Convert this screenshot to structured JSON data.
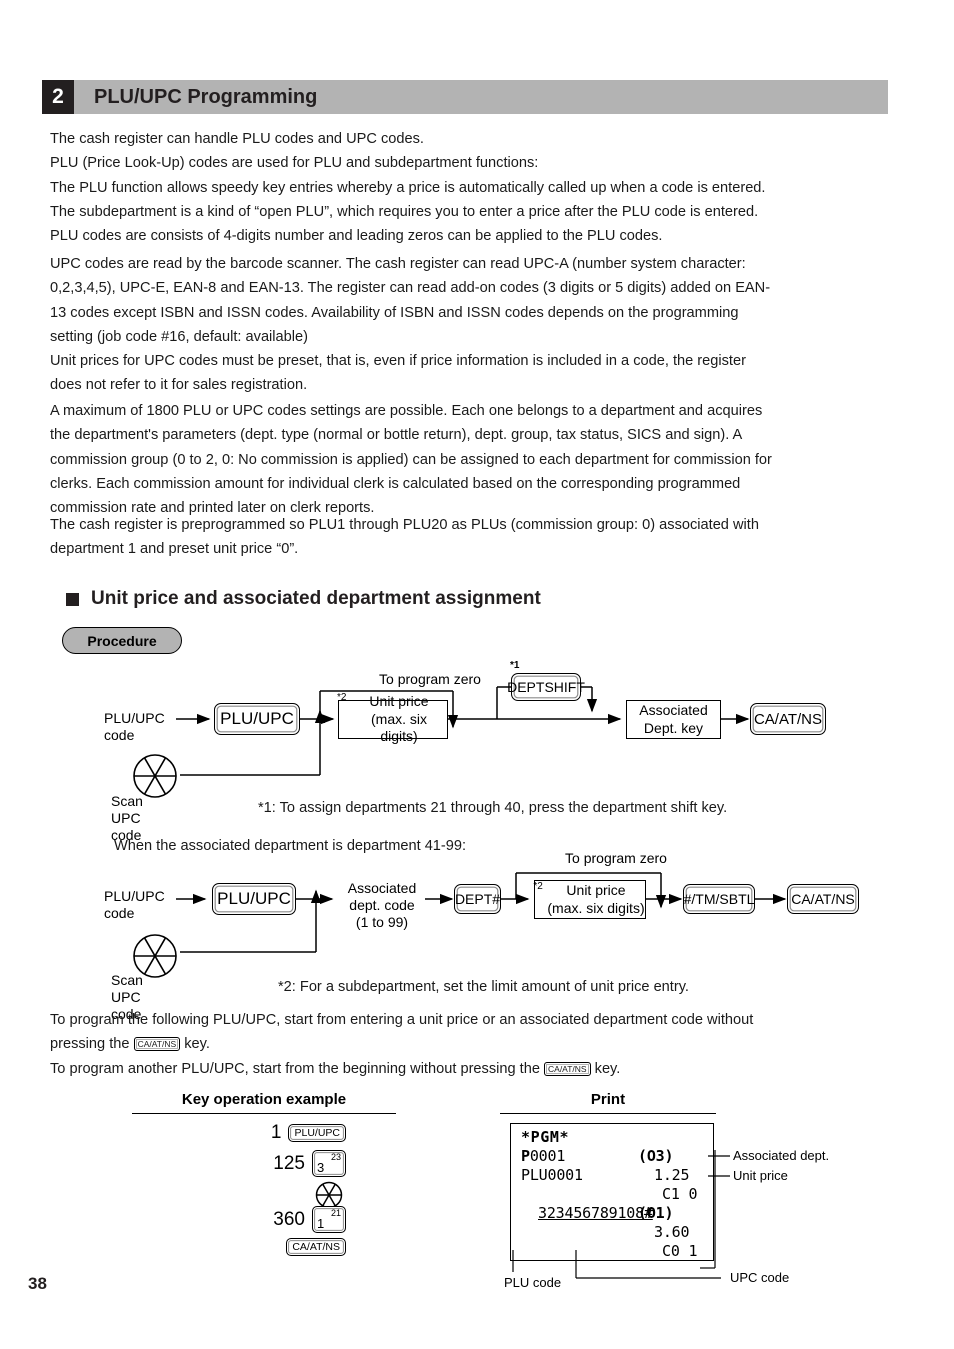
{
  "section": {
    "number": "2",
    "title": "PLU/UPC Programming"
  },
  "intro": {
    "block1": [
      "The cash register can handle PLU codes and UPC codes.",
      "PLU (Price Look-Up) codes are used for PLU and subdepartment functions:",
      "The PLU function allows speedy key entries whereby a price is automatically called up when a code is entered.",
      "The subdepartment is a kind of “open PLU”, which requires you to enter a price after the PLU code is entered.",
      "PLU codes are consists of 4-digits number and leading zeros can be applied to the PLU codes."
    ],
    "block2": [
      "UPC codes are read by the barcode scanner.  The cash register can read UPC-A (number system character:",
      "0,2,3,4,5), UPC-E, EAN-8 and  EAN-13. The register can read add-on codes (3 digits or 5 digits) added on EAN-",
      "13 codes except ISBN and ISSN codes.  Availability of ISBN and ISSN codes depends on the programming",
      "setting (job code #16, default: available)",
      "Unit prices for UPC codes must be preset, that is, even if price information is included in a code, the register",
      "does not refer to it for sales registration."
    ],
    "block3": [
      "A maximum of 1800 PLU or UPC codes settings are possible.  Each one belongs to a department and acquires",
      "the department's parameters (dept. type (normal or bottle return), dept. group, tax status, SICS and sign).  A",
      "commission group (0 to 2, 0: No commission is applied) can be assigned to each department for commission for",
      "clerks.  Each commission amount for individual clerk is calculated based on the corresponding programmed",
      "commission rate and printed later on clerk reports."
    ],
    "block4": [
      "The cash register is preprogrammed so PLU1 through PLU20 as PLUs (commission group: 0) associated with",
      "department 1 and preset unit price “0”."
    ]
  },
  "subheading": "Unit price and associated department assignment",
  "procedure_badge": "Procedure",
  "diagram1": {
    "start_label": "PLU/UPC\ncode",
    "plu_key": "PLU/UPC",
    "scan_label": "Scan UPC code",
    "to_program_zero": "To program zero",
    "unit_price_box": "Unit price\n(max. six digits)",
    "unit_price_sup": "*2",
    "deptshift_key": "DEPTSHIFT",
    "deptshift_sup": "*1",
    "assoc_dept_box": "Associated\nDept. key",
    "ca_key": "CA/AT/NS"
  },
  "footnote1": "*1: To assign departments 21 through 40, press the department shift key.",
  "dept41_line": "When the associated department is department 41-99:",
  "diagram2": {
    "start_label": "PLU/UPC\ncode",
    "plu_key": "PLU/UPC",
    "scan_label": "Scan UPC code",
    "assoc_dept_code": "Associated\ndept. code\n(1 to 99)",
    "dept_key": "DEPT#",
    "to_program_zero": "To program zero",
    "unit_price_box": "Unit price\n(max. six digits)",
    "unit_price_sup": "*2",
    "tmsbtl_key": "#/TM/SBTL",
    "ca_key": "CA/AT/NS"
  },
  "footnote2": "*2: For a subdepartment, set the limit amount of unit price entry.",
  "closing": {
    "line1a": "To program the following PLU/UPC, start from entering a unit price or an associated department code without",
    "line1b_pre": "pressing the ",
    "inline_key": "CA/AT/NS",
    "line1b_post": " key.",
    "line2_pre": "To program another PLU/UPC, start from the beginning without pressing the ",
    "line2_post": " key."
  },
  "example": {
    "keyop_heading": "Key operation example",
    "print_heading": "Print",
    "rows": [
      {
        "num": "1",
        "key_type": "label",
        "key": "PLU/UPC"
      },
      {
        "num": "125",
        "key_type": "numkey",
        "key_main": "3",
        "key_sup": "23"
      },
      {
        "num": "",
        "key_type": "scan",
        "key": "scan-upc-icon"
      },
      {
        "num": "360",
        "key_type": "numkey",
        "key_main": "1",
        "key_sup": "21"
      },
      {
        "num": "",
        "key_type": "label",
        "key": "CA/AT/NS"
      }
    ],
    "receipt": {
      "line_pgm": "*PGM*",
      "line_p_bold": "P",
      "line_p_rest": "0001",
      "line_p_right": "(O3)",
      "line_plu": "PLU0001",
      "line_plu_right": "1.25",
      "line_c1": "C1 0",
      "line_upc": "323456789108#",
      "line_upc_right": "(O1)",
      "line_price2": "3.60",
      "line_c0": "C0 1"
    },
    "callouts": {
      "assoc_dept": "Associated dept.",
      "unit_price": "Unit price",
      "plu_code": "PLU code",
      "upc_code": "UPC code"
    }
  },
  "page_number": "38"
}
